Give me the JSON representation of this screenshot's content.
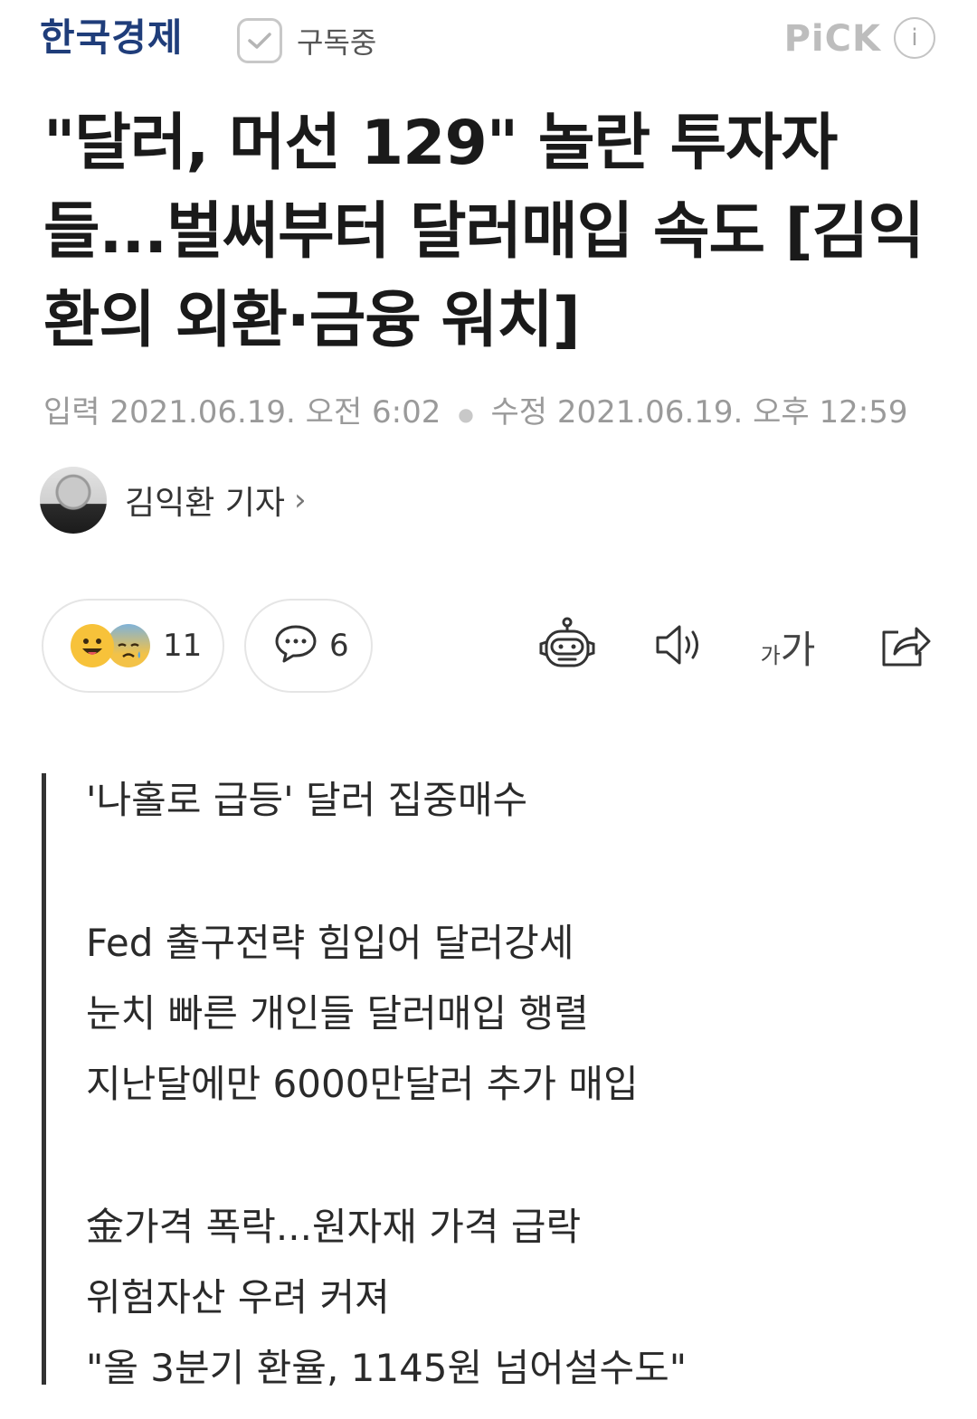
{
  "header": {
    "press_name": "한국경제",
    "subscribe_label": "구독중",
    "pick_label": "PiCK",
    "info_label": "i"
  },
  "article": {
    "title": "\"달러, 머선 129\" 놀란 투자자들...벌써부터 달러매입 속도 [김익환의 외환·금융 워치]",
    "input_label": "입력",
    "input_datetime": "2021.06.19. 오전 6:02",
    "modified_label": "수정",
    "modified_datetime": "2021.06.19. 오후 12:59",
    "reporter": "김익환 기자",
    "reporter_arrow": "›"
  },
  "actions": {
    "reaction_count": "11",
    "comment_count": "6",
    "font_small": "가",
    "font_big": "가"
  },
  "summary": [
    "'나홀로 급등' 달러 집중매수",
    "",
    "Fed 출구전략 힘입어 달러강세",
    "눈치 빠른 개인들 달러매입 행렬",
    "지난달에만 6000만달러 추가 매입",
    "",
    "金가격 폭락...원자재 가격 급락",
    "위험자산 우려 커져",
    "\"올 3분기 환율, 1145원 넘어설수도\""
  ],
  "colors": {
    "press_blue": "#1f3d7a",
    "muted_gray": "#9a9a9a",
    "summary_bar": "#333333"
  }
}
